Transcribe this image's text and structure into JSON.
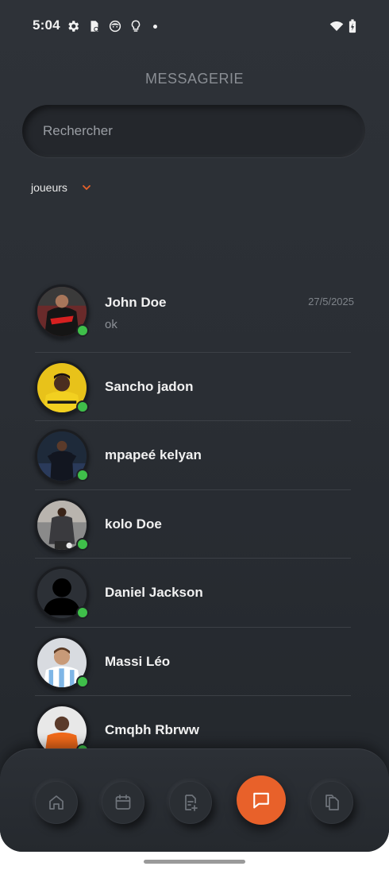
{
  "status_bar": {
    "time": "5:04",
    "icons_left": [
      "settings-icon",
      "sim-battery-icon",
      "face-icon",
      "lightbulb-icon",
      "dot"
    ],
    "icons_right": [
      "wifi-icon",
      "battery-charging-icon"
    ]
  },
  "header": {
    "title": "MESSAGERIE"
  },
  "search": {
    "placeholder": "Rechercher"
  },
  "filter": {
    "label": "joueurs",
    "accent": "#e8612a"
  },
  "contacts": [
    {
      "name": "John Doe",
      "date": "27/5/2025",
      "last_message": "ok",
      "online": true,
      "avatar": "photo-red-kit"
    },
    {
      "name": "Sancho jadon",
      "online": true,
      "avatar": "photo-yellow-kit"
    },
    {
      "name": "mpapeé kelyan",
      "online": true,
      "avatar": "photo-dark-kit"
    },
    {
      "name": "kolo Doe",
      "online": true,
      "avatar": "photo-grey-kit"
    },
    {
      "name": "Daniel Jackson",
      "online": true,
      "avatar": "default-person-icon"
    },
    {
      "name": "Massi Léo",
      "online": true,
      "avatar": "photo-blue-white-kit"
    },
    {
      "name": "Cmqbh Rbrww",
      "online": true,
      "avatar": "photo-orange-kit"
    }
  ],
  "bottom_nav": {
    "items": [
      "home-icon",
      "calendar-icon",
      "document-add-icon",
      "chat-icon",
      "files-icon"
    ],
    "active": "chat-icon"
  },
  "colors": {
    "accent": "#e8612a",
    "online": "#3fbf4a",
    "background": "#2a2e34"
  }
}
